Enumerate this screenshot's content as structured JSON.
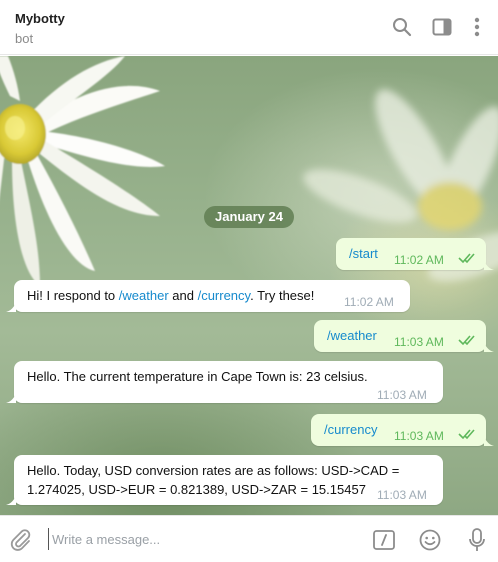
{
  "header": {
    "title": "Mybotty",
    "subtitle": "bot",
    "icons": [
      "search-icon",
      "sidebar-toggle-icon",
      "more-vertical-icon"
    ]
  },
  "chat": {
    "date_label": "January 24",
    "messages": [
      {
        "direction": "outgoing",
        "parts": [
          {
            "text": "/start",
            "command": true
          }
        ],
        "time": "11:02 AM",
        "read": true
      },
      {
        "direction": "incoming",
        "parts": [
          {
            "text": "Hi! I respond to ",
            "command": false
          },
          {
            "text": "/weather",
            "command": true
          },
          {
            "text": " and ",
            "command": false
          },
          {
            "text": "/currency",
            "command": true
          },
          {
            "text": ". Try these!",
            "command": false
          }
        ],
        "time": "11:02 AM"
      },
      {
        "direction": "outgoing",
        "parts": [
          {
            "text": "/weather",
            "command": true
          }
        ],
        "time": "11:03 AM",
        "read": true
      },
      {
        "direction": "incoming",
        "parts": [
          {
            "text": "Hello. The current temperature in Cape Town is: 23 celsius.",
            "command": false
          }
        ],
        "time": "11:03 AM"
      },
      {
        "direction": "outgoing",
        "parts": [
          {
            "text": "/currency",
            "command": true
          }
        ],
        "time": "11:03 AM",
        "read": true
      },
      {
        "direction": "incoming",
        "lines": [
          "Hello. Today, USD conversion rates are as follows: USD->CAD =",
          "1.274025, USD->EUR = 0.821389, USD->ZAR = 15.15457"
        ],
        "time": "11:03 AM"
      }
    ]
  },
  "composer": {
    "placeholder": "Write a message...",
    "value": "",
    "icons": [
      "paperclip-icon",
      "bot-commands-icon",
      "emoji-icon",
      "microphone-icon"
    ]
  },
  "colors": {
    "accent": "#168acd",
    "outgoing_bubble": "#effdde",
    "incoming_bubble": "#ffffff",
    "read_check": "#5fb85c",
    "date_pill": "#607e52"
  }
}
